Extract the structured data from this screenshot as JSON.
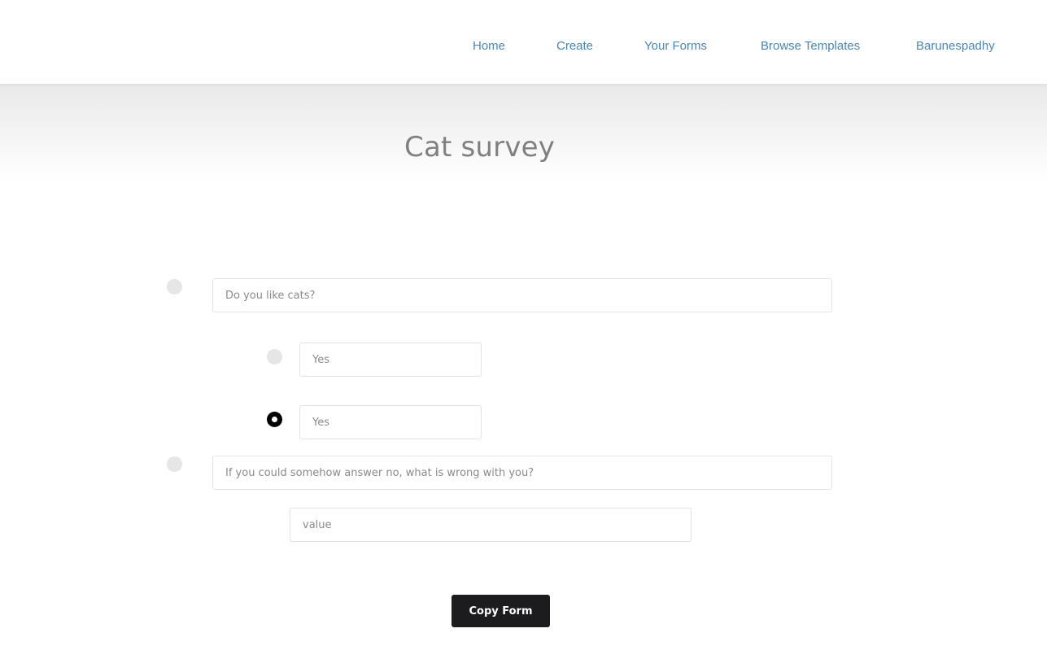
{
  "nav": {
    "items": [
      {
        "label": "Home"
      },
      {
        "label": "Create"
      },
      {
        "label": "Your Forms"
      },
      {
        "label": "Browse Templates"
      },
      {
        "label": "Barunespadhy"
      }
    ]
  },
  "form": {
    "title": "Cat survey",
    "questions": [
      {
        "text": "Do you like cats?",
        "options": [
          {
            "value": "Yes",
            "selected": false
          },
          {
            "value": "Yes",
            "selected": true
          }
        ]
      },
      {
        "text": "If you could somehow answer no, what is wrong with you?",
        "answer_placeholder": "value"
      }
    ],
    "copy_button_label": "Copy Form"
  },
  "colors": {
    "nav_link": "#4a86b8",
    "title": "#808080",
    "button_bg": "#1c1c1e",
    "radio_unselected": "#e6e6e6",
    "radio_selected": "#000000"
  }
}
